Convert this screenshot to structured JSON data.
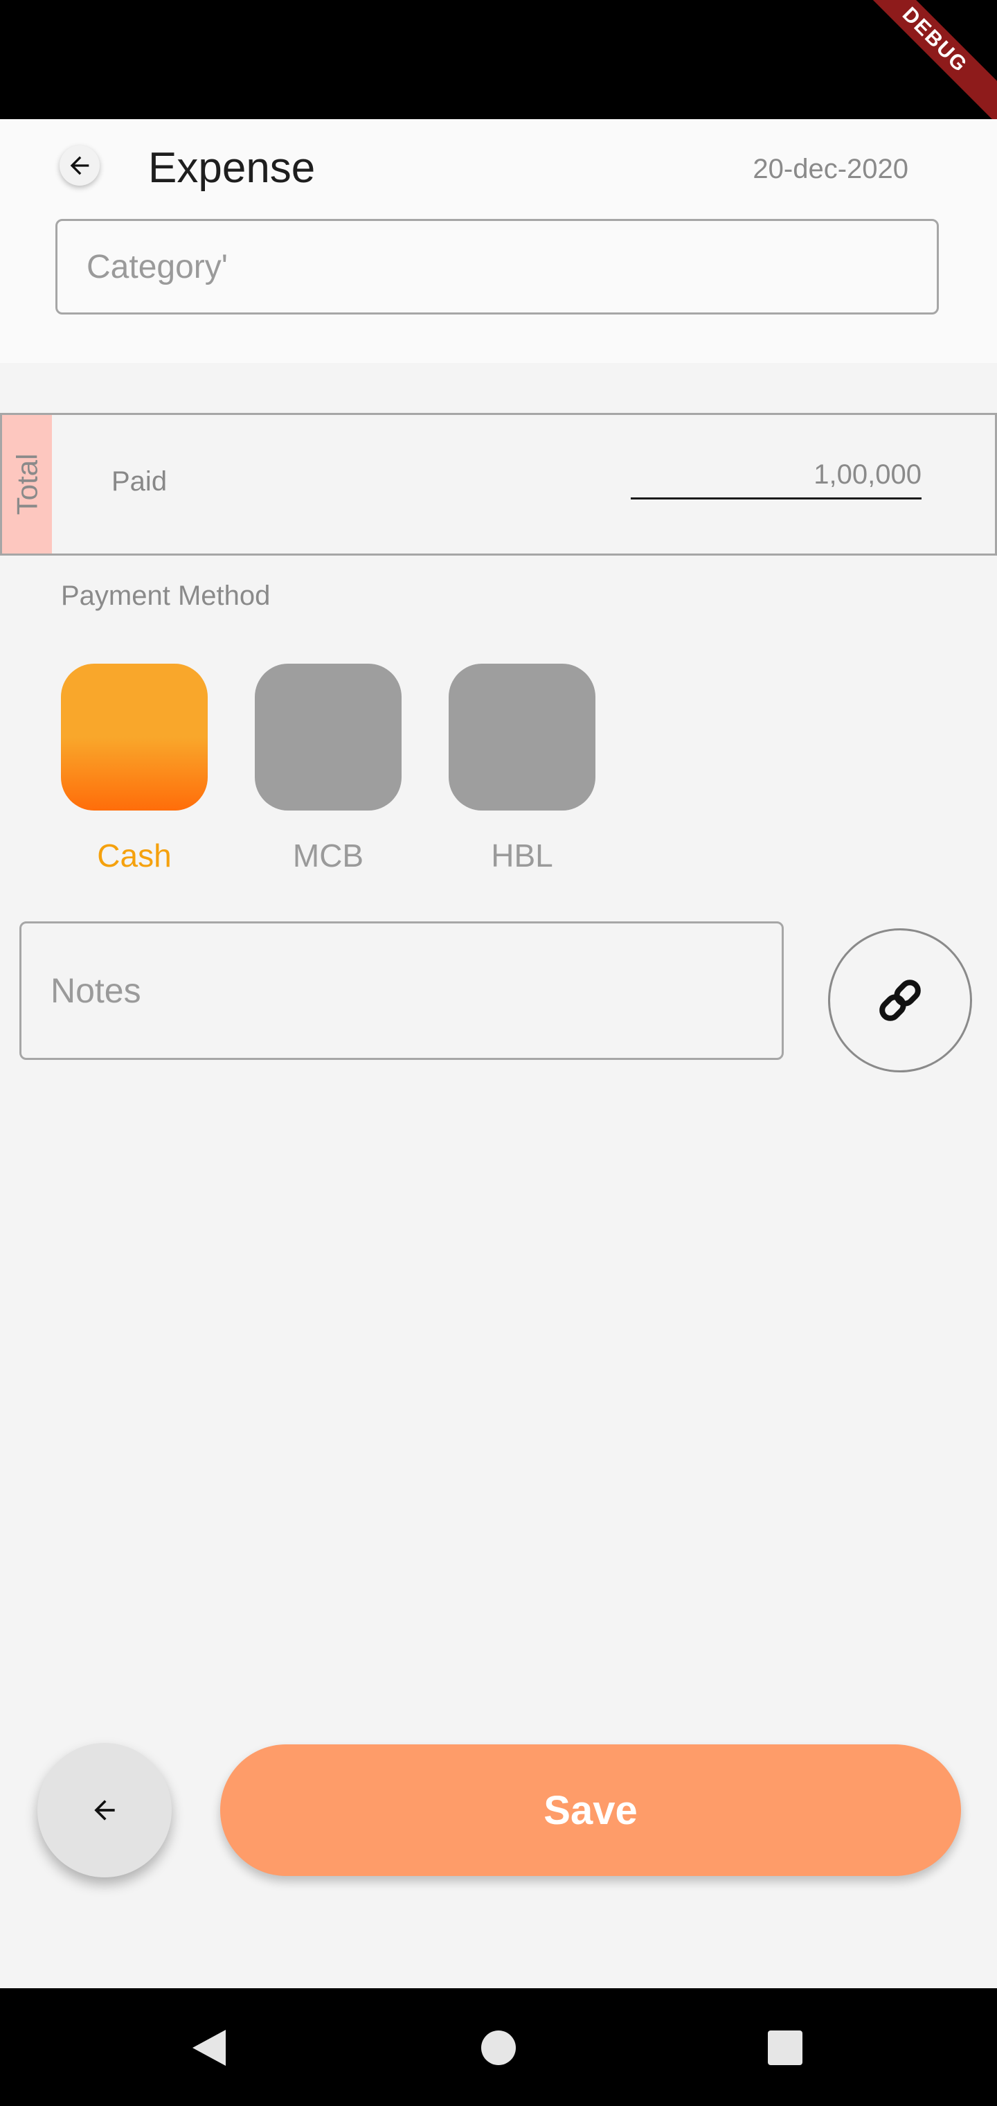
{
  "system": {
    "debug_banner": "DEBUG"
  },
  "header": {
    "title": "Expense",
    "date": "20-dec-2020",
    "back_icon": "arrow-left-icon"
  },
  "category": {
    "placeholder": "Category'"
  },
  "total": {
    "tab_label": "Total",
    "paid_label": "Paid",
    "paid_amount": "1,00,000"
  },
  "payment": {
    "label": "Payment Method",
    "options": [
      {
        "name": "Cash",
        "selected": true
      },
      {
        "name": "MCB",
        "selected": false
      },
      {
        "name": "HBL",
        "selected": false
      }
    ],
    "selected_color": "#f5a10d",
    "unselected_color": "#9e9e9e"
  },
  "notes": {
    "placeholder": "Notes",
    "attach_icon": "link-icon"
  },
  "footer": {
    "save_label": "Save",
    "back_icon": "arrow-left-icon"
  },
  "colors": {
    "accent": "#fe9c69",
    "total_tab": "#fdc7bf"
  },
  "navbar": {
    "icons": [
      "back-triangle-icon",
      "home-circle-icon",
      "recents-square-icon"
    ]
  }
}
